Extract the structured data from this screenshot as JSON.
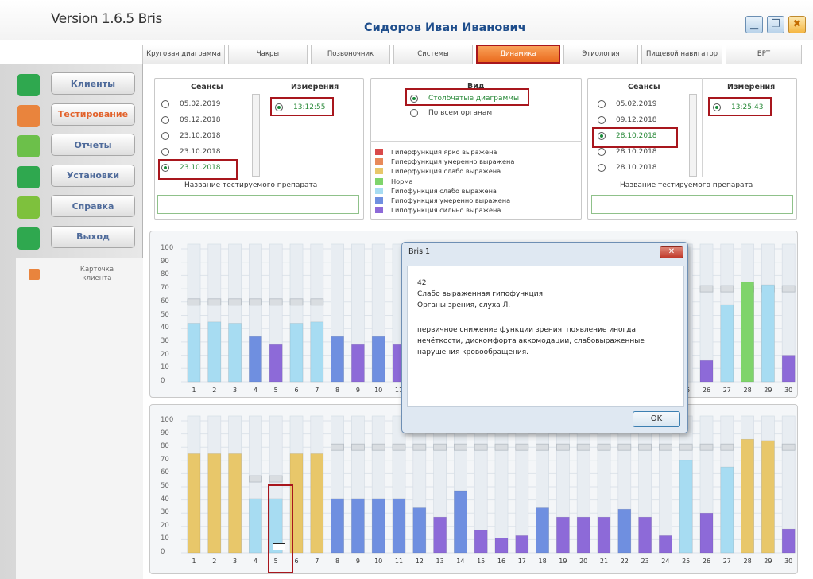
{
  "app": {
    "version": "Version 1.6.5 Bris",
    "user": "Сидоров Иван Иванович"
  },
  "window_controls": {
    "minimize": "▁",
    "restore": "❐",
    "close": "✖"
  },
  "tabs": [
    {
      "label": "Круговая диаграмма",
      "active": false
    },
    {
      "label": "Чакры",
      "active": false
    },
    {
      "label": "Позвоночник",
      "active": false
    },
    {
      "label": "Системы",
      "active": false
    },
    {
      "label": "Динамика",
      "active": true
    },
    {
      "label": "Этиология",
      "active": false
    },
    {
      "label": "Пищевой навигатор",
      "active": false
    },
    {
      "label": "БРТ",
      "active": false
    }
  ],
  "sidebar": {
    "items": [
      {
        "label": "Клиенты",
        "icon": "person-icon",
        "icon_color": "#2fa84f",
        "active": false
      },
      {
        "label": "Тестирование",
        "icon": "user-testing-icon",
        "icon_color": "#e9843d",
        "active": true
      },
      {
        "label": "Отчеты",
        "icon": "checkmark-icon",
        "icon_color": "#6cc04a",
        "active": false
      },
      {
        "label": "Установки",
        "icon": "bars-icon",
        "icon_color": "#2fa84f",
        "active": false
      },
      {
        "label": "Справка",
        "icon": "question-icon",
        "icon_color": "#7ec13d",
        "active": false
      },
      {
        "label": "Выход",
        "icon": "arrow-left-icon",
        "icon_color": "#2fa84f",
        "active": false
      }
    ],
    "card_label": "Карточка клиента"
  },
  "left_session": {
    "sessions_title": "Сеансы",
    "measures_title": "Измерения",
    "sessions": [
      "05.02.2019",
      "09.12.2018",
      "23.10.2018",
      "23.10.2018",
      "23.10.2018"
    ],
    "selected_session_index": 4,
    "measure": "13:12:55",
    "preparation_label": "Название тестируемого препарата",
    "preparation_value": ""
  },
  "right_session": {
    "sessions_title": "Сеансы",
    "measures_title": "Измерения",
    "sessions": [
      "05.02.2019",
      "09.12.2018",
      "28.10.2018",
      "28.10.2018",
      "28.10.2018"
    ],
    "selected_session_index": 2,
    "measure": "13:25:43",
    "preparation_label": "Название тестируемого препарата",
    "preparation_value": ""
  },
  "view": {
    "title": "Вид",
    "options": [
      "Столбчатые диаграммы",
      "По всем органам"
    ],
    "selected_index": 0
  },
  "legend": [
    {
      "label": "Гиперфункция ярко выражена",
      "color": "#d94a4a"
    },
    {
      "label": "Гиперфункция умеренно выражена",
      "color": "#e88a5a"
    },
    {
      "label": "Гиперфункция слабо выражена",
      "color": "#e8c76a"
    },
    {
      "label": "Норма",
      "color": "#7fd46b"
    },
    {
      "label": "Гипофункция слабо выражена",
      "color": "#a7dcf2"
    },
    {
      "label": "Гипофункция умеренно выражена",
      "color": "#6f8fe0"
    },
    {
      "label": "Гипофункция сильно выражена",
      "color": "#8d6ad8"
    }
  ],
  "chart_data": [
    {
      "type": "bar",
      "ylim": [
        0,
        100
      ],
      "yticks": [
        "100",
        "90",
        "80",
        "70",
        "60",
        "50",
        "40",
        "30",
        "20",
        "10",
        "0"
      ],
      "categories": [
        "1",
        "2",
        "3",
        "4",
        "5",
        "6",
        "7",
        "8",
        "9",
        "10",
        "11",
        "12",
        "13",
        "14",
        "15",
        "16",
        "17",
        "18",
        "19",
        "20",
        "21",
        "22",
        "23",
        "24",
        "25",
        "26",
        "27",
        "28",
        "29",
        "30"
      ],
      "values": [
        44,
        45,
        44,
        34,
        28,
        44,
        45,
        34,
        28,
        34,
        28,
        null,
        null,
        null,
        null,
        null,
        null,
        null,
        null,
        null,
        null,
        null,
        null,
        null,
        null,
        16,
        58,
        75,
        73,
        20
      ],
      "colors": [
        "#a7dcf2",
        "#a7dcf2",
        "#a7dcf2",
        "#6f8fe0",
        "#8d6ad8",
        "#a7dcf2",
        "#a7dcf2",
        "#6f8fe0",
        "#8d6ad8",
        "#6f8fe0",
        "#8d6ad8",
        "#6f8fe0",
        "#6f8fe0",
        "#6f8fe0",
        "#6f8fe0",
        "#6f8fe0",
        "#6f8fe0",
        "#6f8fe0",
        "#6f8fe0",
        "#6f8fe0",
        "#6f8fe0",
        "#6f8fe0",
        "#6f8fe0",
        "#6f8fe0",
        "#6f8fe0",
        "#8d6ad8",
        "#a7dcf2",
        "#7fd46b",
        "#a7dcf2",
        "#8d6ad8"
      ],
      "gray_caps": [
        60,
        60,
        60,
        60,
        60,
        60,
        60,
        null,
        null,
        null,
        null,
        null,
        null,
        null,
        null,
        null,
        null,
        null,
        null,
        null,
        null,
        null,
        null,
        null,
        null,
        70,
        70,
        70,
        70,
        70
      ],
      "grid": true
    },
    {
      "type": "bar",
      "ylim": [
        0,
        100
      ],
      "yticks": [
        "100",
        "90",
        "80",
        "70",
        "60",
        "50",
        "40",
        "30",
        "20",
        "10",
        "0"
      ],
      "categories": [
        "1",
        "2",
        "3",
        "4",
        "5",
        "6",
        "7",
        "8",
        "9",
        "10",
        "11",
        "12",
        "13",
        "14",
        "15",
        "16",
        "17",
        "18",
        "19",
        "20",
        "21",
        "22",
        "23",
        "24",
        "25",
        "26",
        "27",
        "28",
        "29",
        "30"
      ],
      "values": [
        75,
        75,
        75,
        41,
        41,
        75,
        75,
        41,
        41,
        41,
        41,
        34,
        27,
        47,
        17,
        11,
        13,
        34,
        27,
        27,
        27,
        33,
        27,
        13,
        70,
        30,
        65,
        86,
        85,
        18
      ],
      "colors": [
        "#e8c76a",
        "#e8c76a",
        "#e8c76a",
        "#a7dcf2",
        "#a7dcf2",
        "#e8c76a",
        "#e8c76a",
        "#6f8fe0",
        "#6f8fe0",
        "#6f8fe0",
        "#6f8fe0",
        "#6f8fe0",
        "#8d6ad8",
        "#6f8fe0",
        "#8d6ad8",
        "#8d6ad8",
        "#8d6ad8",
        "#6f8fe0",
        "#8d6ad8",
        "#8d6ad8",
        "#8d6ad8",
        "#6f8fe0",
        "#8d6ad8",
        "#8d6ad8",
        "#a7dcf2",
        "#8d6ad8",
        "#a7dcf2",
        "#e8c76a",
        "#e8c76a",
        "#8d6ad8"
      ],
      "gray_caps": [
        null,
        null,
        null,
        56,
        56,
        null,
        null,
        80,
        80,
        80,
        80,
        80,
        80,
        80,
        80,
        80,
        80,
        80,
        80,
        80,
        80,
        80,
        80,
        80,
        80,
        80,
        80,
        null,
        null,
        80
      ],
      "grid": true,
      "highlight_category": "5"
    }
  ],
  "dialog": {
    "title": "Bris 1",
    "close": "✕",
    "lines": [
      "42",
      "Слабо выраженная гипофункция",
      "Органы зрения, слуха Л.",
      "",
      "первичное снижение функции зрения, появление иногда",
      "нечёткости, дискомфорта аккомодации, слабовыраженные",
      "нарушения кровообращения."
    ],
    "ok": "OK"
  }
}
